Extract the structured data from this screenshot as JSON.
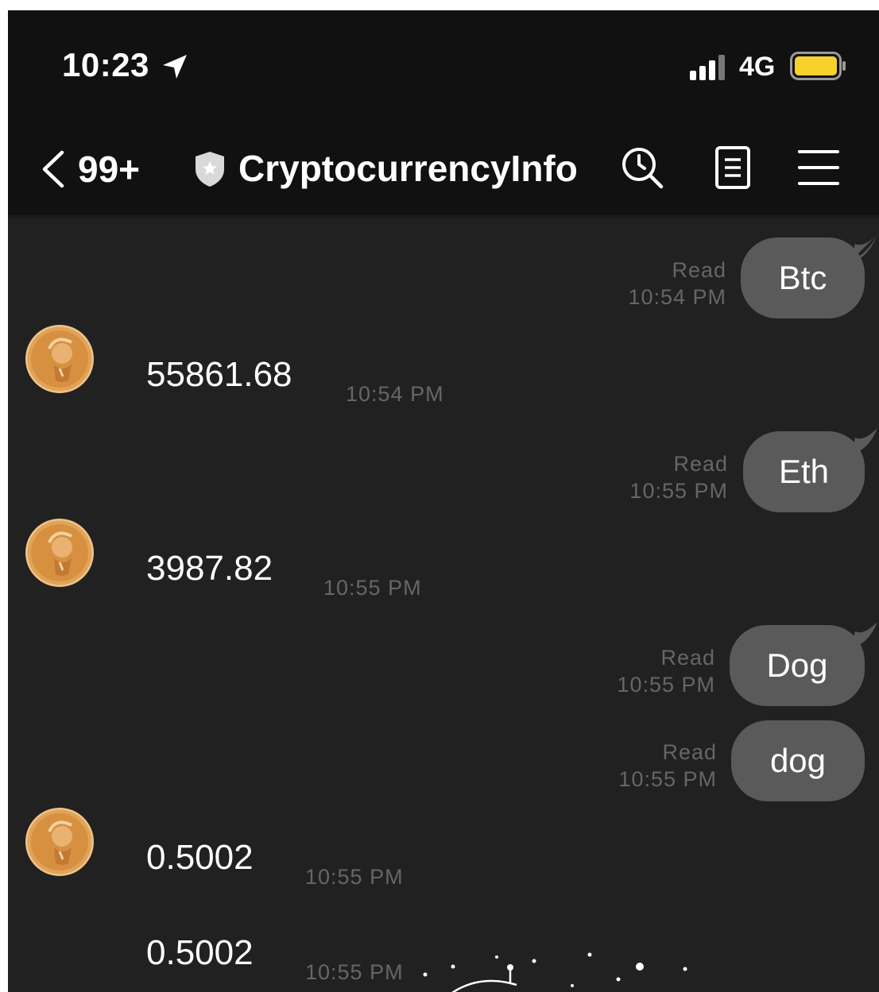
{
  "status_bar": {
    "time": "10:23",
    "network": "4G"
  },
  "header": {
    "unread_count": "99+",
    "title": "CryptocurrencyInfo"
  },
  "icons": {
    "location": "location-arrow-icon",
    "signal": "signal-bars-icon",
    "battery": "battery-icon",
    "back": "chevron-left-icon",
    "shield": "shield-star-icon",
    "search": "search-clock-icon",
    "notes": "note-document-icon",
    "menu": "hamburger-menu-icon",
    "avatar": "coin-avatar-icon"
  },
  "colors": {
    "background": "#212121",
    "header": "#111111",
    "bubble": "#5a5a5a",
    "timestamp": "#666666",
    "battery": "#f7d22c",
    "coin": "#d6903f"
  },
  "messages": {
    "out_1": {
      "text": "Btc",
      "status": "Read",
      "time": "10:54 PM"
    },
    "in_1": {
      "text": "55861.68",
      "time": "10:54 PM"
    },
    "out_2": {
      "text": "Eth",
      "status": "Read",
      "time": "10:55 PM"
    },
    "in_2": {
      "text": "3987.82",
      "time": "10:55 PM"
    },
    "out_3": {
      "text": "Dog",
      "status": "Read",
      "time": "10:55 PM"
    },
    "out_4": {
      "text": "dog",
      "status": "Read",
      "time": "10:55 PM"
    },
    "in_3": {
      "text": "0.5002",
      "time": "10:55 PM"
    },
    "in_4": {
      "text": "0.5002",
      "time": "10:55 PM"
    }
  }
}
